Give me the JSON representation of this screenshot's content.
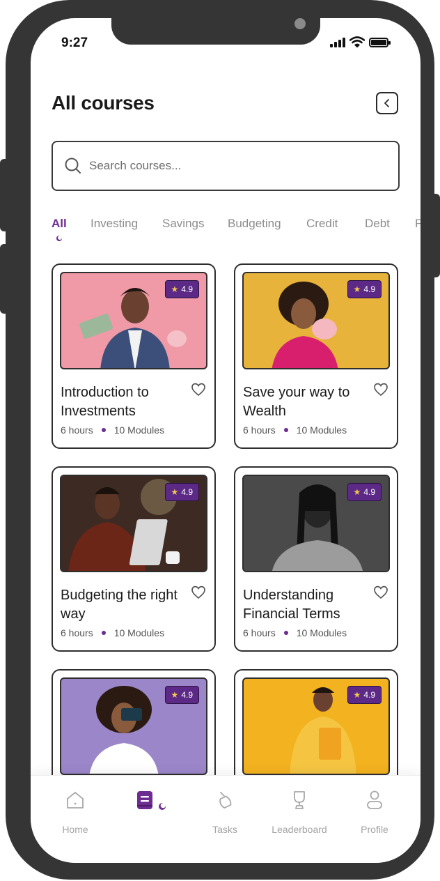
{
  "status": {
    "time": "9:27"
  },
  "header": {
    "title": "All courses"
  },
  "search": {
    "placeholder": "Search courses..."
  },
  "tabs": [
    {
      "label": "All",
      "active": true
    },
    {
      "label": "Investing"
    },
    {
      "label": "Savings"
    },
    {
      "label": "Budgeting"
    },
    {
      "label": "Credit"
    },
    {
      "label": "Debt"
    },
    {
      "label": "F"
    }
  ],
  "courses": [
    {
      "title": "Introduction to Investments",
      "rating": "4.9",
      "hours": "6 hours",
      "modules": "10 Modules",
      "thumb_bg": "#ef9aa6"
    },
    {
      "title": "Save your way to Wealth",
      "rating": "4.9",
      "hours": "6 hours",
      "modules": "10 Modules",
      "thumb_bg": "#e8b33a"
    },
    {
      "title": "Budgeting the right way",
      "rating": "4.9",
      "hours": "6 hours",
      "modules": "10 Modules",
      "thumb_bg": "#6b4a3a"
    },
    {
      "title": "Understanding Financial Terms",
      "rating": "4.9",
      "hours": "6 hours",
      "modules": "10 Modules",
      "thumb_bg": "#5a5a5a"
    },
    {
      "title": "",
      "rating": "4.9",
      "hours": "",
      "modules": "",
      "thumb_bg": "#9b86c9"
    },
    {
      "title": "",
      "rating": "4.9",
      "hours": "",
      "modules": "",
      "thumb_bg": "#f3b21f"
    }
  ],
  "nav": [
    {
      "label": "Home",
      "icon": "home-icon"
    },
    {
      "label": "",
      "icon": "courses-icon",
      "active": true
    },
    {
      "label": "Tasks",
      "icon": "tasks-icon"
    },
    {
      "label": "Leaderboard",
      "icon": "trophy-icon"
    },
    {
      "label": "Profile",
      "icon": "profile-icon"
    }
  ],
  "colors": {
    "accent": "#6d2c91",
    "rating_bg": "#5c2a86",
    "frame": "#353535"
  }
}
